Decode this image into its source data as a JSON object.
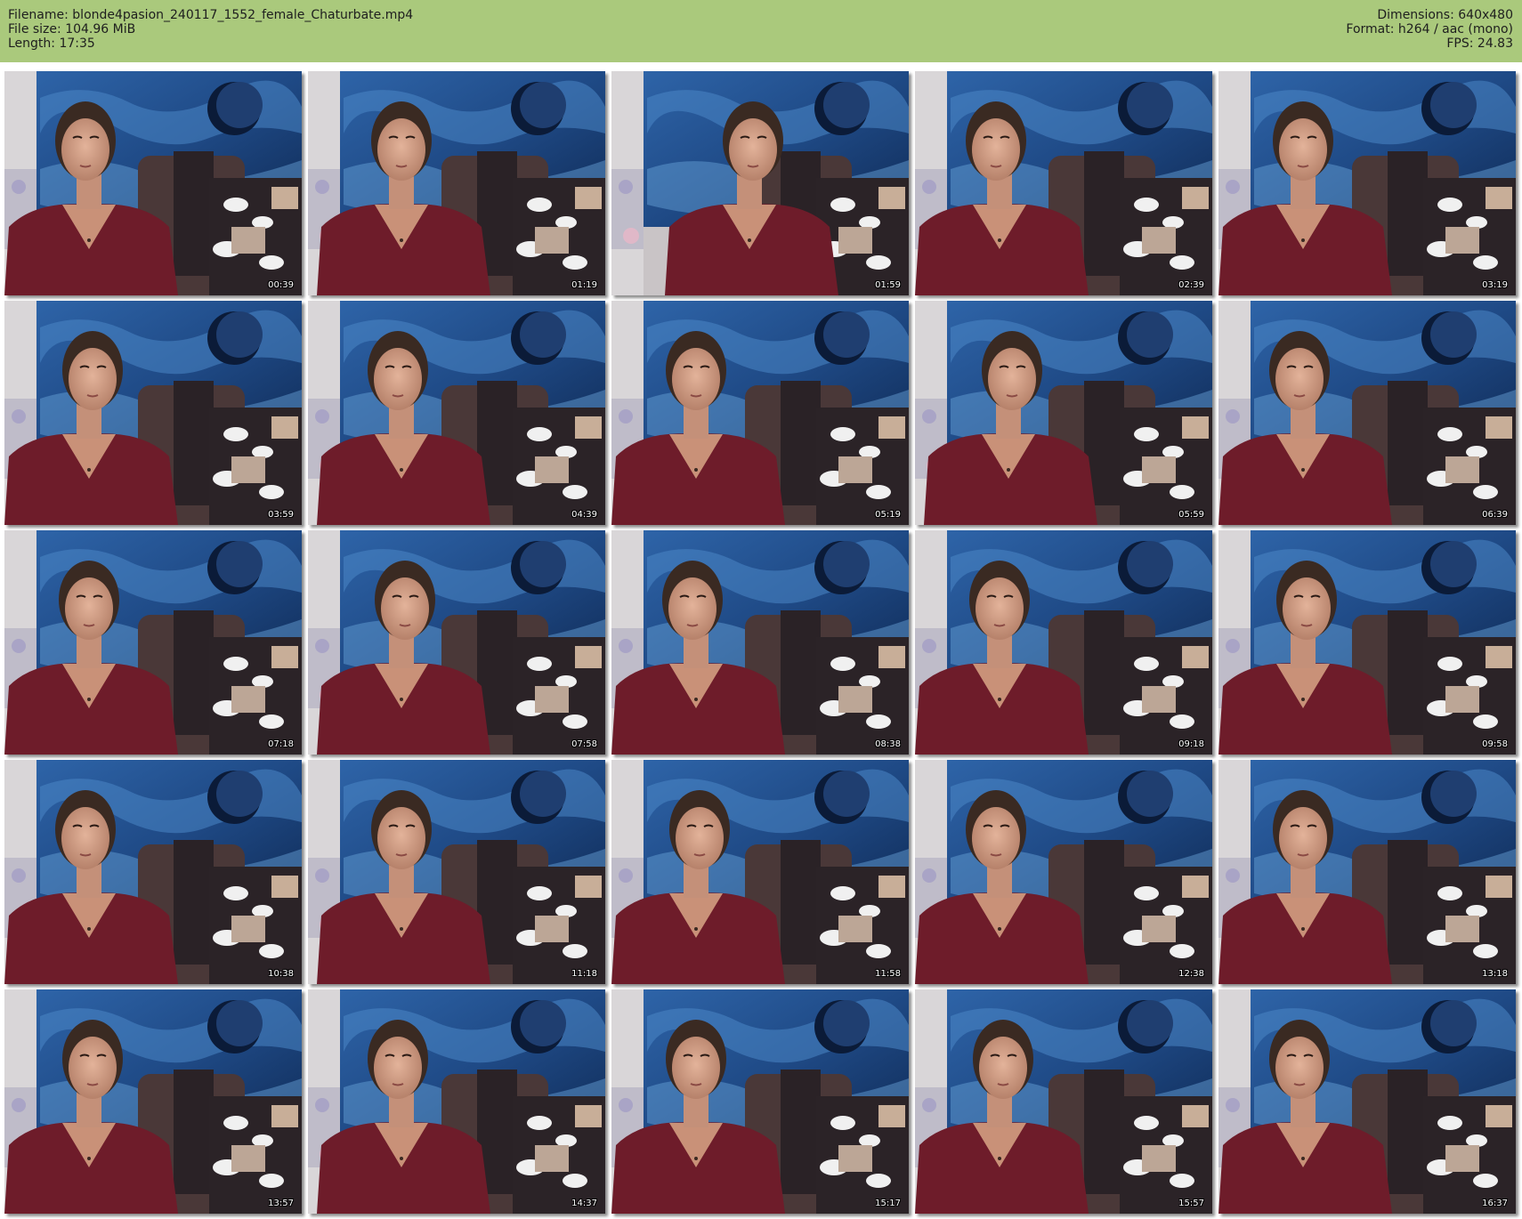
{
  "header": {
    "filename": "Filename: blonde4pasion_240117_1552_female_Chaturbate.mp4",
    "filesize": "File size: 104.96 MiB",
    "length": "Length: 17:35",
    "dimensions": "Dimensions: 640x480",
    "format": "Format: h264 / aac (mono)",
    "fps": "FPS: 24.83"
  },
  "thumbnails": [
    "00:39",
    "01:19",
    "01:59",
    "02:39",
    "03:19",
    "03:59",
    "04:39",
    "05:19",
    "05:59",
    "06:39",
    "07:18",
    "07:58",
    "08:38",
    "09:18",
    "09:58",
    "10:38",
    "11:18",
    "11:58",
    "12:38",
    "13:18",
    "13:57",
    "14:37",
    "15:17",
    "15:57",
    "16:37"
  ],
  "colors": {
    "header_bg": "#aac97c",
    "tapestry": "#1f4a86",
    "sweater": "#6e1c2a",
    "wall": "#c9c4c6",
    "chair": "#2a2226"
  }
}
